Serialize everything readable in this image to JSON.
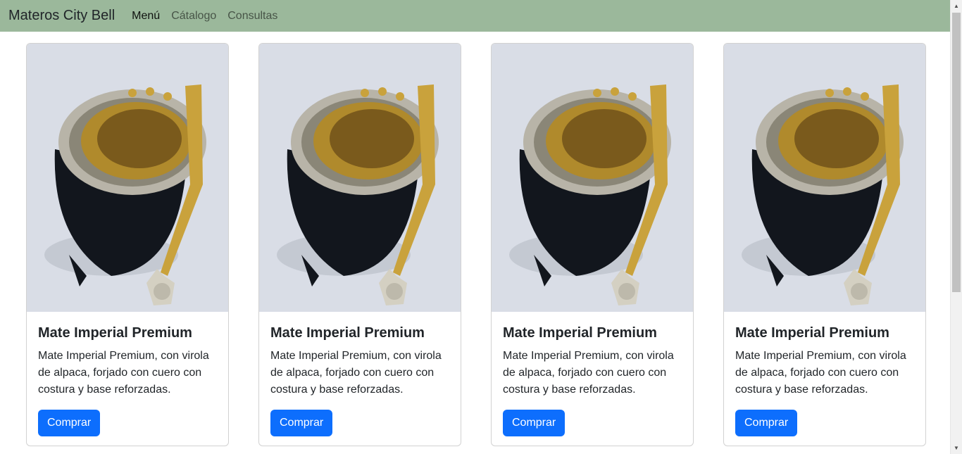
{
  "navbar": {
    "brand": "Materos City Bell",
    "links": [
      {
        "label": "Menú"
      },
      {
        "label": "Cátalogo"
      },
      {
        "label": "Consultas"
      }
    ],
    "background": "#9bb89b"
  },
  "products": [
    {
      "title": "Mate Imperial Premium",
      "description": "Mate Imperial Premium, con virola de alpaca, forjado con cuero con costura y base reforzadas.",
      "button": "Comprar"
    },
    {
      "title": "Mate Imperial Premium",
      "description": "Mate Imperial Premium, con virola de alpaca, forjado con cuero con costura y base reforzadas.",
      "button": "Comprar"
    },
    {
      "title": "Mate Imperial Premium",
      "description": "Mate Imperial Premium, con virola de alpaca, forjado con cuero con costura y base reforzadas.",
      "button": "Comprar"
    },
    {
      "title": "Mate Imperial Premium",
      "description": "Mate Imperial Premium, con virola de alpaca, forjado con cuero con costura y base reforzadas.",
      "button": "Comprar"
    }
  ],
  "colors": {
    "primary_button": "#0d6efd"
  }
}
